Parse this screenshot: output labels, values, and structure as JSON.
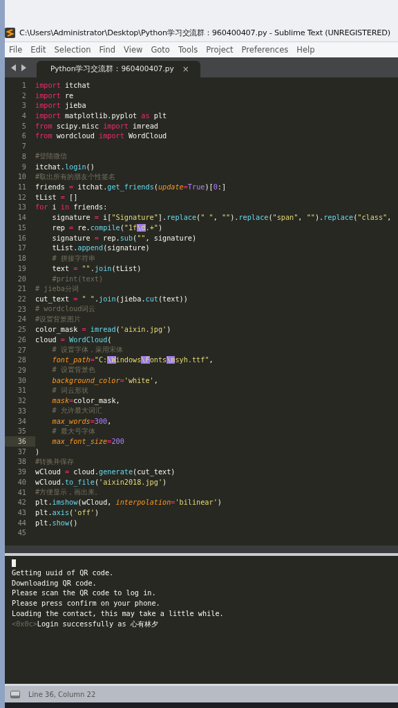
{
  "window": {
    "title": "C:\\Users\\Administrator\\Desktop\\Python学习交流群：960400407.py - Sublime Text (UNREGISTERED)"
  },
  "menu": [
    "File",
    "Edit",
    "Selection",
    "Find",
    "View",
    "Goto",
    "Tools",
    "Project",
    "Preferences",
    "Help"
  ],
  "tabs": [
    {
      "label": "Python学习交流群：960400407.py",
      "close": "×",
      "selected": true
    }
  ],
  "editor": {
    "lines": [
      {
        "number": "1",
        "indented": false,
        "current": false,
        "tokens": [
          {
            "kind": "kw",
            "text": "import"
          },
          {
            "kind": "plain",
            "text": " itchat"
          }
        ]
      },
      {
        "number": "2",
        "indented": false,
        "current": false,
        "tokens": [
          {
            "kind": "kw",
            "text": "import"
          },
          {
            "kind": "plain",
            "text": " re"
          }
        ]
      },
      {
        "number": "3",
        "indented": false,
        "current": false,
        "tokens": [
          {
            "kind": "kw",
            "text": "import"
          },
          {
            "kind": "plain",
            "text": " jieba"
          }
        ]
      },
      {
        "number": "4",
        "indented": false,
        "current": false,
        "tokens": [
          {
            "kind": "kw",
            "text": "import"
          },
          {
            "kind": "plain",
            "text": " matplotlib.pyplot "
          },
          {
            "kind": "kw",
            "text": "as"
          },
          {
            "kind": "plain",
            "text": " plt"
          }
        ]
      },
      {
        "number": "5",
        "indented": false,
        "current": false,
        "tokens": [
          {
            "kind": "kw",
            "text": "from"
          },
          {
            "kind": "plain",
            "text": " scipy.misc "
          },
          {
            "kind": "kw",
            "text": "import"
          },
          {
            "kind": "plain",
            "text": " imread"
          }
        ]
      },
      {
        "number": "6",
        "indented": false,
        "current": false,
        "tokens": [
          {
            "kind": "kw",
            "text": "from"
          },
          {
            "kind": "plain",
            "text": " wordcloud "
          },
          {
            "kind": "kw",
            "text": "import"
          },
          {
            "kind": "plain",
            "text": " WordCloud"
          }
        ]
      },
      {
        "number": "7",
        "current": false
      },
      {
        "number": "8",
        "indented": false,
        "current": false,
        "tokens": [
          {
            "kind": "comment",
            "text": "#登陆微信"
          }
        ]
      },
      {
        "number": "9",
        "indented": false,
        "current": false,
        "tokens": [
          {
            "kind": "plain",
            "text": "itchat."
          },
          {
            "kind": "fn",
            "text": "login"
          },
          {
            "kind": "plain",
            "text": "()"
          }
        ]
      },
      {
        "number": "10",
        "indented": false,
        "current": false,
        "tokens": [
          {
            "kind": "comment",
            "text": "#取出所有的朋友个性签名"
          }
        ]
      },
      {
        "number": "11",
        "indented": false,
        "current": false,
        "tokens": [
          {
            "kind": "plain",
            "text": "friends "
          },
          {
            "kind": "op",
            "text": "="
          },
          {
            "kind": "plain",
            "text": " itchat."
          },
          {
            "kind": "fn",
            "text": "get_friends"
          },
          {
            "kind": "plain",
            "text": "("
          },
          {
            "kind": "param",
            "text": "update"
          },
          {
            "kind": "op",
            "text": "="
          },
          {
            "kind": "num",
            "text": "True"
          },
          {
            "kind": "plain",
            "text": ")["
          },
          {
            "kind": "num",
            "text": "0"
          },
          {
            "kind": "plain",
            "text": ":]"
          }
        ]
      },
      {
        "number": "12",
        "indented": false,
        "current": false,
        "tokens": [
          {
            "kind": "plain",
            "text": "tList "
          },
          {
            "kind": "op",
            "text": "="
          },
          {
            "kind": "plain",
            "text": " []"
          }
        ]
      },
      {
        "number": "13",
        "indented": false,
        "current": false,
        "tokens": [
          {
            "kind": "kw",
            "text": "for"
          },
          {
            "kind": "plain",
            "text": " i "
          },
          {
            "kind": "kw",
            "text": "in"
          },
          {
            "kind": "plain",
            "text": " friends:"
          }
        ]
      },
      {
        "number": "14",
        "indented": true,
        "current": false,
        "tokens": [
          {
            "kind": "plain",
            "text": "signature "
          },
          {
            "kind": "op",
            "text": "="
          },
          {
            "kind": "plain",
            "text": " i["
          },
          {
            "kind": "str",
            "text": "\"Signature\""
          },
          {
            "kind": "plain",
            "text": "]."
          },
          {
            "kind": "fn",
            "text": "replace"
          },
          {
            "kind": "plain",
            "text": "("
          },
          {
            "kind": "str",
            "text": "\" \""
          },
          {
            "kind": "plain",
            "text": ", "
          },
          {
            "kind": "str",
            "text": "\"\""
          },
          {
            "kind": "plain",
            "text": ")."
          },
          {
            "kind": "fn",
            "text": "replace"
          },
          {
            "kind": "plain",
            "text": "("
          },
          {
            "kind": "str",
            "text": "\"span\""
          },
          {
            "kind": "plain",
            "text": ", "
          },
          {
            "kind": "str",
            "text": "\"\""
          },
          {
            "kind": "plain",
            "text": ")."
          },
          {
            "kind": "fn",
            "text": "replace"
          },
          {
            "kind": "plain",
            "text": "("
          },
          {
            "kind": "str",
            "text": "\"class\""
          },
          {
            "kind": "plain",
            "text": ","
          }
        ]
      },
      {
        "number": "15",
        "indented": true,
        "current": false,
        "tokens": [
          {
            "kind": "plain",
            "text": "rep "
          },
          {
            "kind": "op",
            "text": "="
          },
          {
            "kind": "plain",
            "text": " re."
          },
          {
            "kind": "fn",
            "text": "compile"
          },
          {
            "kind": "plain",
            "text": "("
          },
          {
            "kind": "str",
            "text": "\"1f"
          },
          {
            "kind": "match",
            "text": "\\d"
          },
          {
            "kind": "str",
            "text": ".+\""
          },
          {
            "kind": "plain",
            "text": ")"
          }
        ]
      },
      {
        "number": "16",
        "indented": true,
        "current": false,
        "tokens": [
          {
            "kind": "plain",
            "text": "signature "
          },
          {
            "kind": "op",
            "text": "="
          },
          {
            "kind": "plain",
            "text": " rep."
          },
          {
            "kind": "fn",
            "text": "sub"
          },
          {
            "kind": "plain",
            "text": "("
          },
          {
            "kind": "str",
            "text": "\"\""
          },
          {
            "kind": "plain",
            "text": ", signature)"
          }
        ]
      },
      {
        "number": "17",
        "indented": true,
        "current": false,
        "tokens": [
          {
            "kind": "plain",
            "text": "tList."
          },
          {
            "kind": "fn",
            "text": "append"
          },
          {
            "kind": "plain",
            "text": "(signature)"
          }
        ]
      },
      {
        "number": "18",
        "indented": true,
        "current": false,
        "tokens": [
          {
            "kind": "comment",
            "text": "# 拼接字符串"
          }
        ]
      },
      {
        "number": "19",
        "indented": true,
        "current": false,
        "tokens": [
          {
            "kind": "plain",
            "text": "text "
          },
          {
            "kind": "op",
            "text": "= "
          },
          {
            "kind": "str",
            "text": "\"\""
          },
          {
            "kind": "plain",
            "text": "."
          },
          {
            "kind": "fn",
            "text": "join"
          },
          {
            "kind": "plain",
            "text": "(tList)"
          }
        ]
      },
      {
        "number": "20",
        "indented": true,
        "current": false,
        "tokens": [
          {
            "kind": "comment",
            "text": "#print(text)"
          }
        ]
      },
      {
        "number": "21",
        "indented": false,
        "current": false,
        "tokens": [
          {
            "kind": "comment",
            "text": "# jieba分词"
          }
        ]
      },
      {
        "number": "22",
        "indented": false,
        "current": false,
        "tokens": [
          {
            "kind": "plain",
            "text": "cut_text "
          },
          {
            "kind": "op",
            "text": "= "
          },
          {
            "kind": "str",
            "text": "\" \""
          },
          {
            "kind": "plain",
            "text": "."
          },
          {
            "kind": "fn",
            "text": "join"
          },
          {
            "kind": "plain",
            "text": "(jieba."
          },
          {
            "kind": "fn",
            "text": "cut"
          },
          {
            "kind": "plain",
            "text": "(text))"
          }
        ]
      },
      {
        "number": "23",
        "indented": false,
        "current": false,
        "tokens": [
          {
            "kind": "comment",
            "text": "# wordcloud词云"
          }
        ]
      },
      {
        "number": "24",
        "indented": false,
        "current": false,
        "tokens": [
          {
            "kind": "comment",
            "text": "#设置背景图片"
          }
        ]
      },
      {
        "number": "25",
        "indented": false,
        "current": false,
        "tokens": [
          {
            "kind": "plain",
            "text": "color_mask "
          },
          {
            "kind": "op",
            "text": "= "
          },
          {
            "kind": "fn",
            "text": "imread"
          },
          {
            "kind": "plain",
            "text": "("
          },
          {
            "kind": "str",
            "text": "'aixin.jpg'"
          },
          {
            "kind": "plain",
            "text": ")"
          }
        ]
      },
      {
        "number": "26",
        "indented": false,
        "current": false,
        "tokens": [
          {
            "kind": "plain",
            "text": "cloud "
          },
          {
            "kind": "op",
            "text": "= "
          },
          {
            "kind": "fn",
            "text": "WordCloud"
          },
          {
            "kind": "plain",
            "text": "("
          }
        ]
      },
      {
        "number": "27",
        "indented": true,
        "current": false,
        "tokens": [
          {
            "kind": "comment",
            "text": "# 设置字体，采用宋体"
          }
        ]
      },
      {
        "number": "28",
        "indented": true,
        "current": false,
        "tokens": [
          {
            "kind": "param",
            "text": "font_path"
          },
          {
            "kind": "op",
            "text": "="
          },
          {
            "kind": "str",
            "text": "\"C:"
          },
          {
            "kind": "match",
            "text": "\\W"
          },
          {
            "kind": "str",
            "text": "indows"
          },
          {
            "kind": "match",
            "text": "\\F"
          },
          {
            "kind": "str",
            "text": "onts"
          },
          {
            "kind": "match",
            "text": "\\m"
          },
          {
            "kind": "str",
            "text": "syh.ttf\""
          },
          {
            "kind": "plain",
            "text": ","
          }
        ]
      },
      {
        "number": "29",
        "indented": true,
        "current": false,
        "tokens": [
          {
            "kind": "comment",
            "text": "# 设置背景色"
          }
        ]
      },
      {
        "number": "30",
        "indented": true,
        "current": false,
        "tokens": [
          {
            "kind": "param",
            "text": "background_color"
          },
          {
            "kind": "op",
            "text": "="
          },
          {
            "kind": "str",
            "text": "'white'"
          },
          {
            "kind": "plain",
            "text": ","
          }
        ]
      },
      {
        "number": "31",
        "indented": true,
        "current": false,
        "tokens": [
          {
            "kind": "comment",
            "text": "# 词云形状"
          }
        ]
      },
      {
        "number": "32",
        "indented": true,
        "current": false,
        "tokens": [
          {
            "kind": "param",
            "text": "mask"
          },
          {
            "kind": "op",
            "text": "="
          },
          {
            "kind": "plain",
            "text": "color_mask,"
          }
        ]
      },
      {
        "number": "33",
        "indented": true,
        "current": false,
        "tokens": [
          {
            "kind": "comment",
            "text": "# 允许最大词汇"
          }
        ]
      },
      {
        "number": "34",
        "indented": true,
        "current": false,
        "tokens": [
          {
            "kind": "param",
            "text": "max_words"
          },
          {
            "kind": "op",
            "text": "="
          },
          {
            "kind": "num",
            "text": "300"
          },
          {
            "kind": "plain",
            "text": ","
          }
        ]
      },
      {
        "number": "35",
        "indented": true,
        "current": false,
        "tokens": [
          {
            "kind": "comment",
            "text": "# 最大号字体"
          }
        ]
      },
      {
        "number": "36",
        "indented": true,
        "current": true,
        "tokens": [
          {
            "kind": "param",
            "text": "max_font_size"
          },
          {
            "kind": "op",
            "text": "="
          },
          {
            "kind": "num",
            "text": "200"
          }
        ]
      },
      {
        "number": "37",
        "indented": false,
        "current": false,
        "tokens": [
          {
            "kind": "plain",
            "text": ")"
          }
        ]
      },
      {
        "number": "38",
        "indented": false,
        "current": false,
        "tokens": [
          {
            "kind": "comment",
            "text": "#转换并保存"
          }
        ]
      },
      {
        "number": "39",
        "indented": false,
        "current": false,
        "tokens": [
          {
            "kind": "plain",
            "text": "wCloud "
          },
          {
            "kind": "op",
            "text": "="
          },
          {
            "kind": "plain",
            "text": " cloud."
          },
          {
            "kind": "fn",
            "text": "generate"
          },
          {
            "kind": "plain",
            "text": "(cut_text)"
          }
        ]
      },
      {
        "number": "40",
        "indented": false,
        "current": false,
        "tokens": [
          {
            "kind": "plain",
            "text": "wCloud."
          },
          {
            "kind": "fn",
            "text": "to_file"
          },
          {
            "kind": "plain",
            "text": "("
          },
          {
            "kind": "str",
            "text": "'aixin2018.jpg'"
          },
          {
            "kind": "plain",
            "text": ")"
          }
        ]
      },
      {
        "number": "41",
        "indented": false,
        "current": false,
        "tokens": [
          {
            "kind": "comment",
            "text": "#方便显示，画出来。"
          }
        ]
      },
      {
        "number": "42",
        "indented": false,
        "current": false,
        "tokens": [
          {
            "kind": "plain",
            "text": "plt."
          },
          {
            "kind": "fn",
            "text": "imshow"
          },
          {
            "kind": "plain",
            "text": "(wCloud, "
          },
          {
            "kind": "param",
            "text": "interpolation"
          },
          {
            "kind": "op",
            "text": "="
          },
          {
            "kind": "str",
            "text": "'bilinear'"
          },
          {
            "kind": "plain",
            "text": ")"
          }
        ]
      },
      {
        "number": "43",
        "indented": false,
        "current": false,
        "tokens": [
          {
            "kind": "plain",
            "text": "plt."
          },
          {
            "kind": "fn",
            "text": "axis"
          },
          {
            "kind": "plain",
            "text": "("
          },
          {
            "kind": "str",
            "text": "'off'"
          },
          {
            "kind": "plain",
            "text": ")"
          }
        ]
      },
      {
        "number": "44",
        "indented": false,
        "current": false,
        "tokens": [
          {
            "kind": "plain",
            "text": "plt."
          },
          {
            "kind": "fn",
            "text": "show"
          },
          {
            "kind": "plain",
            "text": "()"
          }
        ]
      },
      {
        "number": "45",
        "current": false
      }
    ]
  },
  "console": {
    "lines": [
      [
        {
          "kind": "plain",
          "text": "Getting uuid of QR code."
        }
      ],
      [
        {
          "kind": "plain",
          "text": "Downloading QR code."
        }
      ],
      [
        {
          "kind": "plain",
          "text": "Please scan the QR code to log in."
        }
      ],
      [
        {
          "kind": "plain",
          "text": "Please press confirm on your phone."
        }
      ],
      [
        {
          "kind": "plain",
          "text": "Loading the contact, this may take a little while."
        }
      ],
      [
        {
          "kind": "control",
          "text": "<0x0c>"
        },
        {
          "kind": "plain",
          "text": "Login successfully as 心有林夕"
        }
      ]
    ]
  },
  "status_bar": {
    "text": "Line 36, Column 22"
  }
}
